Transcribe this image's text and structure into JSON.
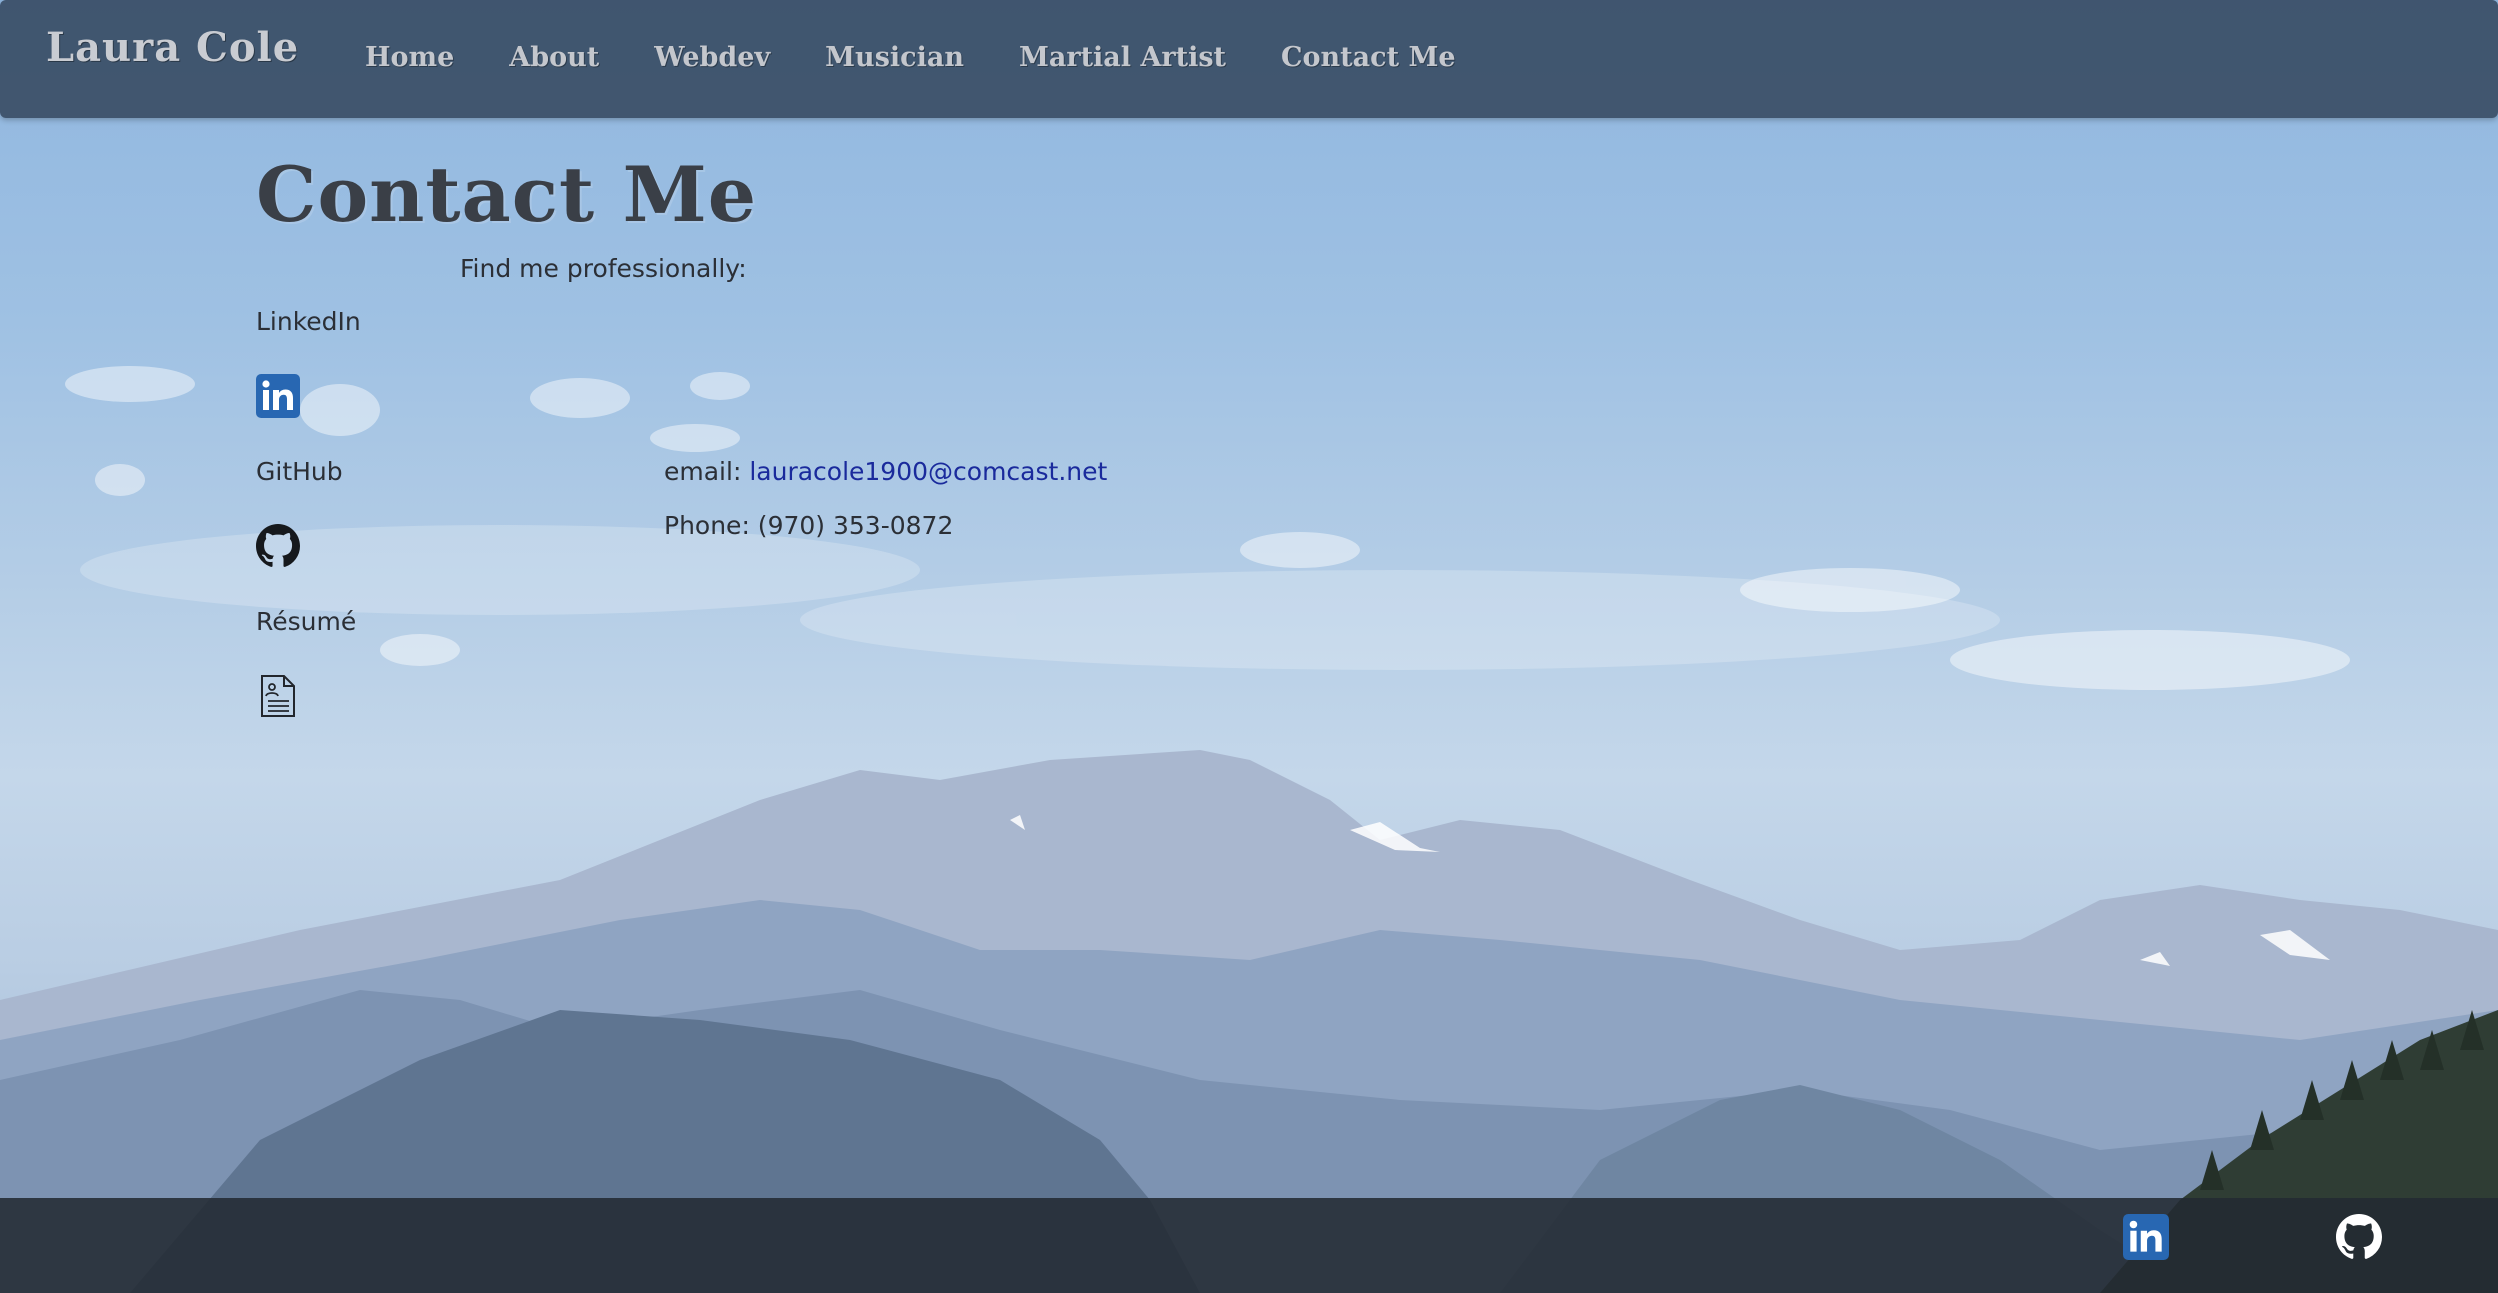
{
  "header": {
    "brand": "Laura Cole",
    "nav": [
      {
        "label": "Home"
      },
      {
        "label": "About"
      },
      {
        "label": "Webdev"
      },
      {
        "label": "Musician"
      },
      {
        "label": "Martial Artist"
      },
      {
        "label": "Contact Me"
      }
    ]
  },
  "main": {
    "title": "Contact Me",
    "intro": "Find me professionally:",
    "profiles": [
      {
        "label": "LinkedIn",
        "icon": "linkedin-icon"
      },
      {
        "label": "GitHub",
        "icon": "github-icon"
      },
      {
        "label": "Résumé",
        "icon": "resume-document-icon"
      }
    ],
    "contact": {
      "email_label": "email:",
      "email": "lauracole1900@comcast.net",
      "phone": "Phone: (970) 353-0872"
    }
  },
  "footer": {
    "icons": [
      "linkedin-icon",
      "github-icon"
    ]
  },
  "colors": {
    "navbar": "#3c5068",
    "linkedin": "#2867b2",
    "link": "#1a2a9c",
    "footer": "#232a32"
  }
}
